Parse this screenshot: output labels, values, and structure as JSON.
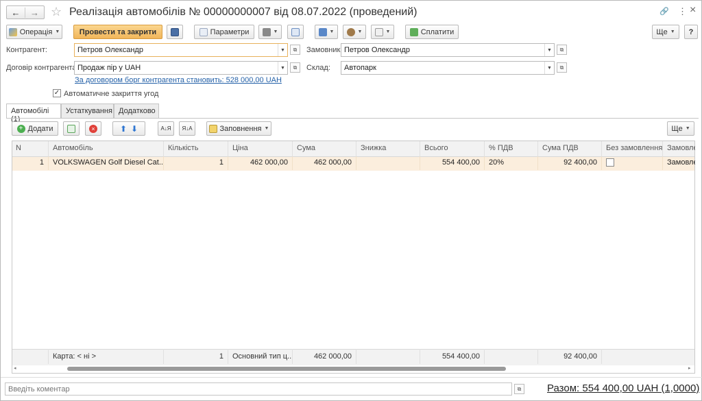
{
  "window": {
    "title": "Реалізація автомобілів № 00000000007 від 08.07.2022 (проведений)"
  },
  "icons": {
    "back": "←",
    "forward": "→",
    "star": "☆",
    "link": "🔗",
    "more": "⋮",
    "close": "×"
  },
  "toolbar": {
    "operation_label": "Операція",
    "post_close_label": "Провести та закрити",
    "params_label": "Параметри",
    "pay_label": "Сплатити",
    "more_label": "Ще",
    "help_label": "?"
  },
  "form": {
    "counterparty_label": "Контрагент:",
    "counterparty_value": "Петров Олександр",
    "contract_label": "Договір контрагента:",
    "contract_value": "Продаж пір у UAH",
    "debt_link": "За договором борг контрагента становить: 528 000,00 UAH",
    "auto_close_label": "Автоматичне закриття угод",
    "auto_close_checked": true,
    "customer_label": "Замовник:",
    "customer_value": "Петров Олександр",
    "warehouse_label": "Склад:",
    "warehouse_value": "Автопарк"
  },
  "tabs": [
    {
      "label": "Автомобілі (1)",
      "selected": true
    },
    {
      "label": "Устаткування",
      "selected": false
    },
    {
      "label": "Додатково",
      "selected": false
    }
  ],
  "table_toolbar": {
    "add_label": "Додати",
    "fill_label": "Заповнення",
    "more_label": "Ще"
  },
  "table": {
    "columns": [
      "N",
      "Автомобіль",
      "Кількість",
      "Ціна",
      "Сума",
      "Знижка",
      "Всього",
      "% ПДВ",
      "Сума ПДВ",
      "Без замовлення",
      "Замовле"
    ],
    "rows": [
      {
        "n": "1",
        "car": "VOLKSWAGEN Golf Diesel Cat...",
        "qty": "1",
        "price": "462 000,00",
        "sum": "462 000,00",
        "discount": "",
        "total": "554 400,00",
        "vat_rate": "20%",
        "vat_sum": "92 400,00",
        "no_order": false,
        "order": "Замовле"
      }
    ],
    "footer": {
      "card": "Карта: < ні >",
      "qty": "1",
      "price_type": "Основний тип ц...",
      "sum": "462 000,00",
      "total": "554 400,00",
      "vat_sum": "92 400,00"
    }
  },
  "bottom": {
    "comment_placeholder": "Введіть коментар",
    "total": "Разом: 554 400,00 UAH (1,0000)"
  },
  "colors": {
    "accent": "#f5c26b",
    "row_selected": "#fbeedd",
    "link": "#2461a8"
  }
}
